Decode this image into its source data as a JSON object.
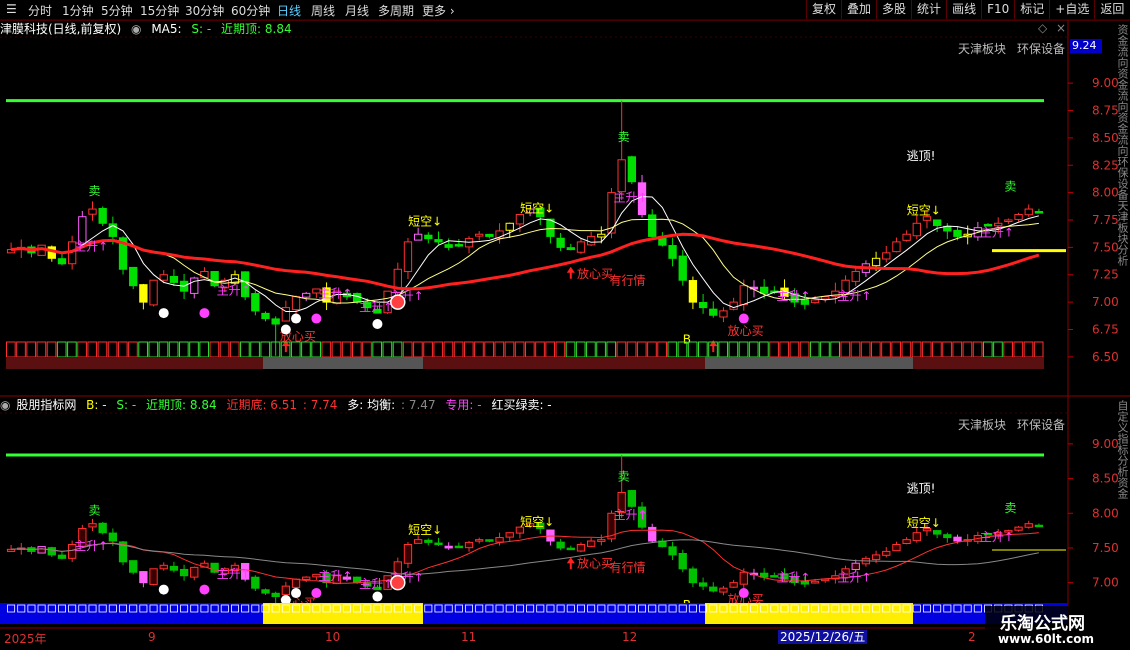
{
  "toolbar": {
    "periods": [
      "分时",
      "1分钟",
      "5分钟",
      "15分钟",
      "30分钟",
      "60分钟",
      "日线",
      "周线",
      "月线",
      "多周期",
      "更多"
    ],
    "active_period": "日线",
    "buttons": [
      "复权",
      "叠加",
      "多股",
      "统计",
      "画线",
      "F10",
      "标记",
      "+自选",
      "返回"
    ]
  },
  "upper": {
    "title": "津膜科技(日线,前复权)",
    "ma_label": "MA5:",
    "s_label": "S: -",
    "recent_top": "近期顶: 8.84",
    "tags": [
      "天津板块",
      "环保设备"
    ],
    "current_price": "9.24",
    "y_ticks": [
      "9.00",
      "8.75",
      "8.50",
      "8.25",
      "8.00",
      "7.75",
      "7.50",
      "7.25",
      "7.00",
      "6.75",
      "6.50"
    ],
    "annotations": {
      "sell": "卖",
      "short": "短空↓",
      "rise": "主升↑",
      "buy": "放心买",
      "market": "有行情",
      "escape": "逃顶!",
      "b": "B"
    }
  },
  "lower": {
    "title": "股朋指标网",
    "b_label": "B: -",
    "s_label": "S: -",
    "recent_top": "近期顶: 8.84",
    "recent_bottom": "近期底: 6.51",
    "bottom_extra": ": 7.74",
    "multi": "多: 均衡:",
    "balance_val": ": 7.47",
    "special": "专用: -",
    "redgreen": "红买绿卖: -",
    "tags": [
      "天津板块",
      "环保设备"
    ],
    "y_ticks": [
      "9.00",
      "8.50",
      "8.00",
      "7.50",
      "7.00"
    ],
    "annotations": {
      "sell": "卖",
      "short": "短空↓",
      "rise": "主升↑",
      "buy": "放心买",
      "market": "有行情",
      "escape": "逃顶!",
      "b": "B"
    }
  },
  "xaxis": {
    "labels": [
      "2025年",
      "9",
      "10",
      "11",
      "12",
      "2"
    ],
    "selected_date": "2025/12/26/五"
  },
  "logo": {
    "main": "乐淘公式网",
    "sub": "www.60lt.com"
  },
  "colors": {
    "up": "#ff3030",
    "down": "#00e000",
    "ma_long": "#ff2020",
    "top_line": "#33ff33",
    "accent_yellow": "#ffff00"
  },
  "chart_data": {
    "type": "candlestick",
    "ylim": [
      6.4,
      9.3
    ],
    "close": [
      7.48,
      7.5,
      7.45,
      7.52,
      7.4,
      7.35,
      7.55,
      7.78,
      7.85,
      7.72,
      7.6,
      7.3,
      7.15,
      7.0,
      7.2,
      7.25,
      7.18,
      7.1,
      7.22,
      7.28,
      7.15,
      7.2,
      7.25,
      7.05,
      6.92,
      6.85,
      6.8,
      6.95,
      7.05,
      7.08,
      7.12,
      7.0,
      7.1,
      7.05,
      7.0,
      6.95,
      6.9,
      7.1,
      7.3,
      7.55,
      7.62,
      7.58,
      7.55,
      7.5,
      7.52,
      7.58,
      7.62,
      7.6,
      7.65,
      7.72,
      7.8,
      7.85,
      7.78,
      7.6,
      7.5,
      7.48,
      7.55,
      7.6,
      7.62,
      8.0,
      8.3,
      8.1,
      7.8,
      7.6,
      7.52,
      7.4,
      7.2,
      7.0,
      6.95,
      6.88,
      6.92,
      7.0,
      7.15,
      7.12,
      7.08,
      7.1,
      7.05,
      7.0,
      6.98,
      7.02,
      7.05,
      7.1,
      7.2,
      7.28,
      7.35,
      7.4,
      7.45,
      7.55,
      7.62,
      7.72,
      7.78,
      7.7,
      7.65,
      7.6,
      7.62,
      7.68,
      7.7,
      7.72,
      7.75,
      7.8,
      7.85,
      7.82
    ]
  }
}
